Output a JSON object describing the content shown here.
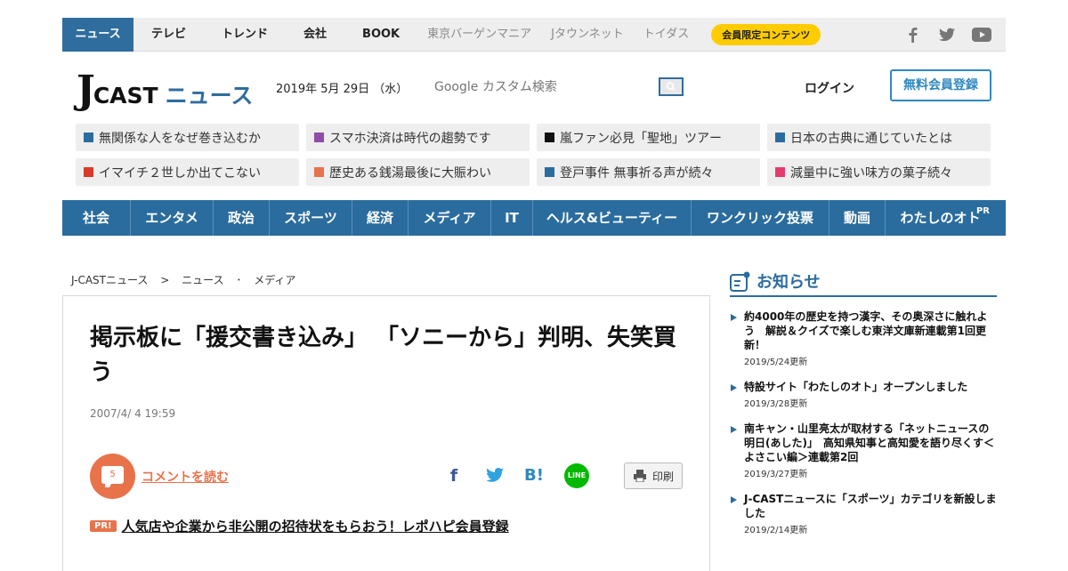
{
  "topnav": {
    "items": [
      "ニュース",
      "テレビ",
      "トレンド",
      "会社",
      "BOOK"
    ],
    "muted_items": [
      "東京バーゲンマニア",
      "Jタウンネット",
      "トイダス"
    ],
    "premium": "会員限定コンテンツ",
    "social_icons": [
      "facebook-icon",
      "twitter-icon",
      "youtube-icon"
    ]
  },
  "header": {
    "logo_j": "J",
    "logo_cast": "CAST",
    "logo_news": "ニュース",
    "date": "2019年 5月 29日 （水）",
    "search_placeholder": "Google カスタム検索",
    "login": "ログイン",
    "signup": "無料会員登録"
  },
  "topics": [
    {
      "label": "無関係な人をなぜ巻き込むか",
      "color": "#2b6c9e"
    },
    {
      "label": "スマホ決済は時代の趨勢です",
      "color": "#8e4ea8"
    },
    {
      "label": "嵐ファン必見「聖地」ツアー",
      "color": "#111111"
    },
    {
      "label": "日本の古典に通じていたとは",
      "color": "#2b6c9e"
    },
    {
      "label": "イマイチ２世しか出てこない",
      "color": "#d93a2b"
    },
    {
      "label": "歴史ある銭湯最後に大賑わい",
      "color": "#e8724a"
    },
    {
      "label": "登戸事件 無事祈る声が続々",
      "color": "#2b6c9e"
    },
    {
      "label": "減量中に強い味方の菓子続々",
      "color": "#e63b6f"
    }
  ],
  "categories": [
    "社会",
    "エンタメ",
    "政治",
    "スポーツ",
    "経済",
    "メディア",
    "IT",
    "ヘルス&ビューティー",
    "ワンクリック投票",
    "動画",
    "わたしのオト"
  ],
  "category_pr": "PR",
  "breadcrumb": [
    "J-CASTニュース",
    ">",
    "ニュース",
    "･",
    "メディア"
  ],
  "article": {
    "title": "掲示板に「援交書き込み」 「ソニーから」判明、失笑買う",
    "timestamp": "2007/4/ 4 19:59",
    "comment_count": "5",
    "comment_link": "コメントを読む",
    "print": "印刷",
    "pr_badge": "PR!",
    "pr_text": "人気店や企業から非公開の招待状をもらおう！レポハピ会員登録"
  },
  "sidebar": {
    "heading": "お知らせ",
    "items": [
      {
        "text": "約4000年の歴史を持つ漢字、その奥深さに触れよう　解説＆クイズで楽しむ東洋文庫新連載第1回更新！",
        "date": "2019/5/24更新"
      },
      {
        "text": "特設サイト「わたしのオト」オープンしました",
        "date": "2019/3/28更新"
      },
      {
        "text": "南キャン・山里亮太が取材する「ネットニュースの明日(あした)」　高知県知事と高知愛を語り尽くす＜よさこい編＞連載第2回",
        "date": "2019/3/27更新"
      },
      {
        "text": "J-CASTニュースに「スポーツ」カテゴリを新設しました",
        "date": "2019/2/14更新"
      }
    ]
  }
}
